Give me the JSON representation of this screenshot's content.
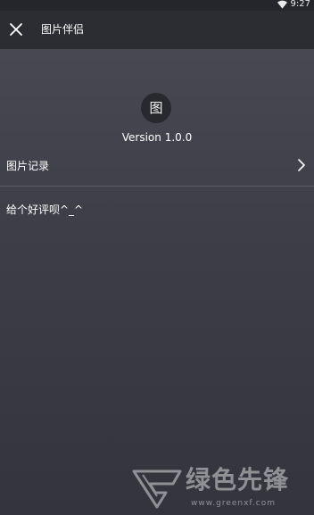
{
  "status_bar": {
    "time": "9:27",
    "icons": [
      "wifi-icon"
    ]
  },
  "app_bar": {
    "close_icon": "close-icon",
    "title": "图片伴侣"
  },
  "app_info": {
    "icon_glyph": "图",
    "version": "Version 1.0.0"
  },
  "menu": {
    "items": [
      {
        "label": "图片记录",
        "icon": "chevron-right-icon"
      },
      {
        "label": "给个好评呗^_^"
      }
    ]
  },
  "watermark": {
    "brand": "绿色先锋",
    "url": "www.greenxf.com"
  },
  "colors": {
    "app_bar": "#2c2d33",
    "background_top": "#4a4b55",
    "background_bottom": "#33343c",
    "divider": "#5b5c66",
    "text": "#ffffff"
  }
}
